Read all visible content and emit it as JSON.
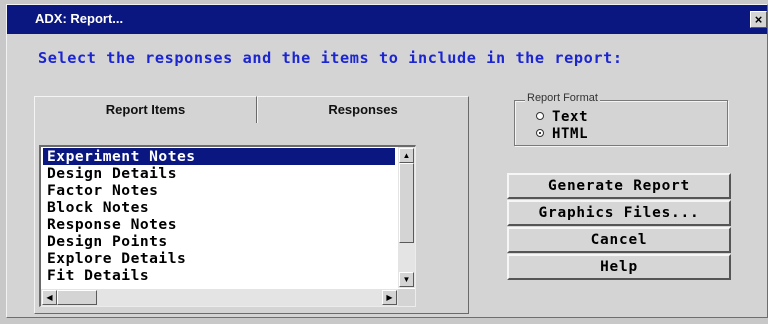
{
  "window": {
    "title": "ADX: Report...",
    "close_label": "×"
  },
  "instruction": "Select the responses and the items to include in the report:",
  "tabs": [
    {
      "label": "Report Items",
      "active": true
    },
    {
      "label": "Responses",
      "active": false
    }
  ],
  "report_items": [
    {
      "label": "Experiment Notes",
      "selected": true
    },
    {
      "label": "Design Details",
      "selected": false
    },
    {
      "label": "Factor Notes",
      "selected": false
    },
    {
      "label": "Block Notes",
      "selected": false
    },
    {
      "label": "Response Notes",
      "selected": false
    },
    {
      "label": "Design Points",
      "selected": false
    },
    {
      "label": "Explore Details",
      "selected": false
    },
    {
      "label": "Fit Details",
      "selected": false
    }
  ],
  "scrollbars": {
    "up_arrow": "▲",
    "down_arrow": "▼",
    "left_arrow": "◀",
    "right_arrow": "▶"
  },
  "report_format": {
    "legend": "Report Format",
    "options": [
      {
        "label": "Text",
        "checked": false
      },
      {
        "label": "HTML",
        "checked": true
      }
    ]
  },
  "buttons": {
    "generate": "Generate Report",
    "graphics": "Graphics Files...",
    "cancel": "Cancel",
    "help": "Help"
  },
  "colors": {
    "titlebar": "#0b1780",
    "instruction_text": "#1b25d0",
    "selection": "#0b1780",
    "dialog_face": "#d4d4d4"
  }
}
